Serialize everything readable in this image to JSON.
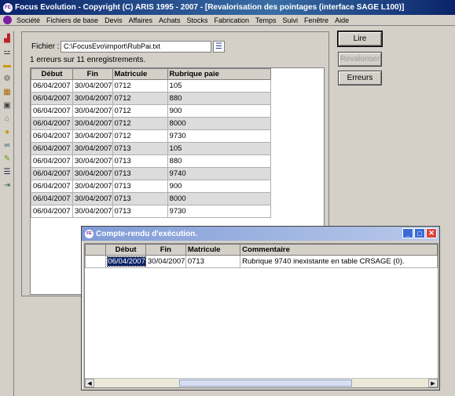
{
  "window": {
    "title": "Focus Evolution   -   Copyright (C) ARIS 1995 - 2007 - [Revalorisation des pointages (interface SAGE L100)]"
  },
  "menu": [
    "Société",
    "Fichiers de base",
    "Devis",
    "Affaires",
    "Achats",
    "Stocks",
    "Fabrication",
    "Temps",
    "Suivi",
    "Fenêtre",
    "Aide"
  ],
  "form": {
    "fichier_label": "Fichier :",
    "fichier_value": "C:\\FocusEvo\\import\\RubPai.txt",
    "status": "1 erreurs sur 11 enregistrements."
  },
  "buttons": {
    "lire": "Lire",
    "revaloriser": "Revaloriser",
    "erreurs": "Erreurs"
  },
  "table": {
    "headers": [
      "Début",
      "Fin",
      "Matricule",
      "Rubrique paie"
    ],
    "rows": [
      [
        "06/04/2007",
        "30/04/2007",
        "0712",
        "105"
      ],
      [
        "06/04/2007",
        "30/04/2007",
        "0712",
        "880"
      ],
      [
        "06/04/2007",
        "30/04/2007",
        "0712",
        "900"
      ],
      [
        "06/04/2007",
        "30/04/2007",
        "0712",
        "8000"
      ],
      [
        "06/04/2007",
        "30/04/2007",
        "0712",
        "9730"
      ],
      [
        "06/04/2007",
        "30/04/2007",
        "0713",
        "105"
      ],
      [
        "06/04/2007",
        "30/04/2007",
        "0713",
        "880"
      ],
      [
        "06/04/2007",
        "30/04/2007",
        "0713",
        "9740"
      ],
      [
        "06/04/2007",
        "30/04/2007",
        "0713",
        "900"
      ],
      [
        "06/04/2007",
        "30/04/2007",
        "0713",
        "8000"
      ],
      [
        "06/04/2007",
        "30/04/2007",
        "0713",
        "9730"
      ]
    ]
  },
  "dialog": {
    "title": "Compte-rendu d'exécution.",
    "headers": [
      "Début",
      "Fin",
      "Matricule",
      "Commentaire"
    ],
    "rows": [
      [
        "06/04/2007",
        "30/04/2007",
        "0713",
        "Rubrique 9740 inexistante en table CRSAGE (0)."
      ]
    ]
  },
  "toolbar_icons": [
    "chart-icon",
    "steps-icon",
    "folder-icon",
    "gear-icon",
    "grid-icon",
    "calendar-icon",
    "building-icon",
    "globe-icon",
    "link-icon",
    "pencil-icon",
    "tree-icon",
    "exit-icon"
  ]
}
